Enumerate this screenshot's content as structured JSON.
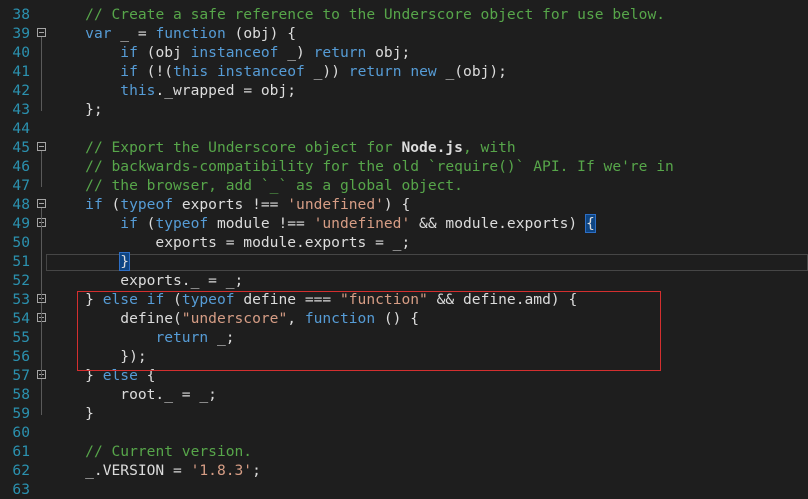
{
  "editor": {
    "lines": [
      {
        "num": "38",
        "tokens": [
          {
            "t": "    "
          },
          {
            "t": "// Create a safe reference to the Underscore object for use below.",
            "c": "cm"
          }
        ]
      },
      {
        "num": "39",
        "fold": true,
        "tokens": [
          {
            "t": "    "
          },
          {
            "t": "var",
            "c": "kw"
          },
          {
            "t": " _ = "
          },
          {
            "t": "function",
            "c": "kw"
          },
          {
            "t": " (obj) {"
          }
        ]
      },
      {
        "num": "40",
        "tokens": [
          {
            "t": "        "
          },
          {
            "t": "if",
            "c": "kw"
          },
          {
            "t": " (obj "
          },
          {
            "t": "instanceof",
            "c": "kw"
          },
          {
            "t": " _) "
          },
          {
            "t": "return",
            "c": "kw"
          },
          {
            "t": " obj;"
          }
        ]
      },
      {
        "num": "41",
        "tokens": [
          {
            "t": "        "
          },
          {
            "t": "if",
            "c": "kw"
          },
          {
            "t": " (!("
          },
          {
            "t": "this",
            "c": "kw"
          },
          {
            "t": " "
          },
          {
            "t": "instanceof",
            "c": "kw"
          },
          {
            "t": " _)) "
          },
          {
            "t": "return",
            "c": "kw"
          },
          {
            "t": " "
          },
          {
            "t": "new",
            "c": "kw"
          },
          {
            "t": " _(obj);"
          }
        ]
      },
      {
        "num": "42",
        "tokens": [
          {
            "t": "        "
          },
          {
            "t": "this",
            "c": "kw"
          },
          {
            "t": "._wrapped = obj;"
          }
        ]
      },
      {
        "num": "43",
        "tokens": [
          {
            "t": "    };"
          }
        ]
      },
      {
        "num": "44",
        "tokens": []
      },
      {
        "num": "45",
        "fold": true,
        "tokens": [
          {
            "t": "    "
          },
          {
            "t": "// Export the Underscore object for ",
            "c": "cm"
          },
          {
            "t": "Node.js",
            "c": "bd"
          },
          {
            "t": ", with",
            "c": "cm"
          }
        ]
      },
      {
        "num": "46",
        "tokens": [
          {
            "t": "    "
          },
          {
            "t": "// backwards-compatibility for the old `require()` API. If we're in",
            "c": "cm"
          }
        ]
      },
      {
        "num": "47",
        "tokens": [
          {
            "t": "    "
          },
          {
            "t": "// the browser, add `_` as a global object.",
            "c": "cm"
          }
        ]
      },
      {
        "num": "48",
        "fold": true,
        "tokens": [
          {
            "t": "    "
          },
          {
            "t": "if",
            "c": "kw"
          },
          {
            "t": " ("
          },
          {
            "t": "typeof",
            "c": "kw"
          },
          {
            "t": " exports !== "
          },
          {
            "t": "'undefined'",
            "c": "st"
          },
          {
            "t": ") {"
          }
        ]
      },
      {
        "num": "49",
        "fold": true,
        "tokens": [
          {
            "t": "        "
          },
          {
            "t": "if",
            "c": "kw"
          },
          {
            "t": " ("
          },
          {
            "t": "typeof",
            "c": "kw"
          },
          {
            "t": " module !== "
          },
          {
            "t": "'undefined'",
            "c": "st"
          },
          {
            "t": " && module.exports) "
          },
          {
            "t": "{",
            "c": "hl"
          }
        ]
      },
      {
        "num": "50",
        "tokens": [
          {
            "t": "            exports = module.exports = _;"
          }
        ]
      },
      {
        "num": "51",
        "tokens": [
          {
            "t": "        "
          },
          {
            "t": "}",
            "c": "hl"
          }
        ]
      },
      {
        "num": "52",
        "tokens": [
          {
            "t": "        exports._ = _;"
          }
        ]
      },
      {
        "num": "53",
        "fold": true,
        "tokens": [
          {
            "t": "    } "
          },
          {
            "t": "else",
            "c": "kw"
          },
          {
            "t": " "
          },
          {
            "t": "if",
            "c": "kw"
          },
          {
            "t": " ("
          },
          {
            "t": "typeof",
            "c": "kw"
          },
          {
            "t": " define === "
          },
          {
            "t": "\"function\"",
            "c": "st"
          },
          {
            "t": " && define.amd) {"
          }
        ]
      },
      {
        "num": "54",
        "fold": true,
        "tokens": [
          {
            "t": "        define("
          },
          {
            "t": "\"underscore\"",
            "c": "st"
          },
          {
            "t": ", "
          },
          {
            "t": "function",
            "c": "kw"
          },
          {
            "t": " () {"
          }
        ]
      },
      {
        "num": "55",
        "tokens": [
          {
            "t": "            "
          },
          {
            "t": "return",
            "c": "kw"
          },
          {
            "t": " _;"
          }
        ]
      },
      {
        "num": "56",
        "tokens": [
          {
            "t": "        });"
          }
        ]
      },
      {
        "num": "57",
        "fold": true,
        "tokens": [
          {
            "t": "    } "
          },
          {
            "t": "else",
            "c": "kw"
          },
          {
            "t": " {"
          }
        ]
      },
      {
        "num": "58",
        "tokens": [
          {
            "t": "        root._ = _;"
          }
        ]
      },
      {
        "num": "59",
        "tokens": [
          {
            "t": "    }"
          }
        ]
      },
      {
        "num": "60",
        "tokens": []
      },
      {
        "num": "61",
        "tokens": [
          {
            "t": "    "
          },
          {
            "t": "// Current version.",
            "c": "cm"
          }
        ]
      },
      {
        "num": "62",
        "tokens": [
          {
            "t": "    _.VERSION = "
          },
          {
            "t": "'1.8.3'",
            "c": "st"
          },
          {
            "t": ";"
          }
        ]
      },
      {
        "num": "63",
        "tokens": []
      }
    ]
  },
  "colors": {
    "background": "#1e1e1e",
    "line_number": "#2b91af",
    "comment": "#57a64a",
    "keyword": "#569cd6",
    "string": "#d69d85",
    "plain": "#dcdcdc",
    "highlight_box": "#d32f2f"
  }
}
